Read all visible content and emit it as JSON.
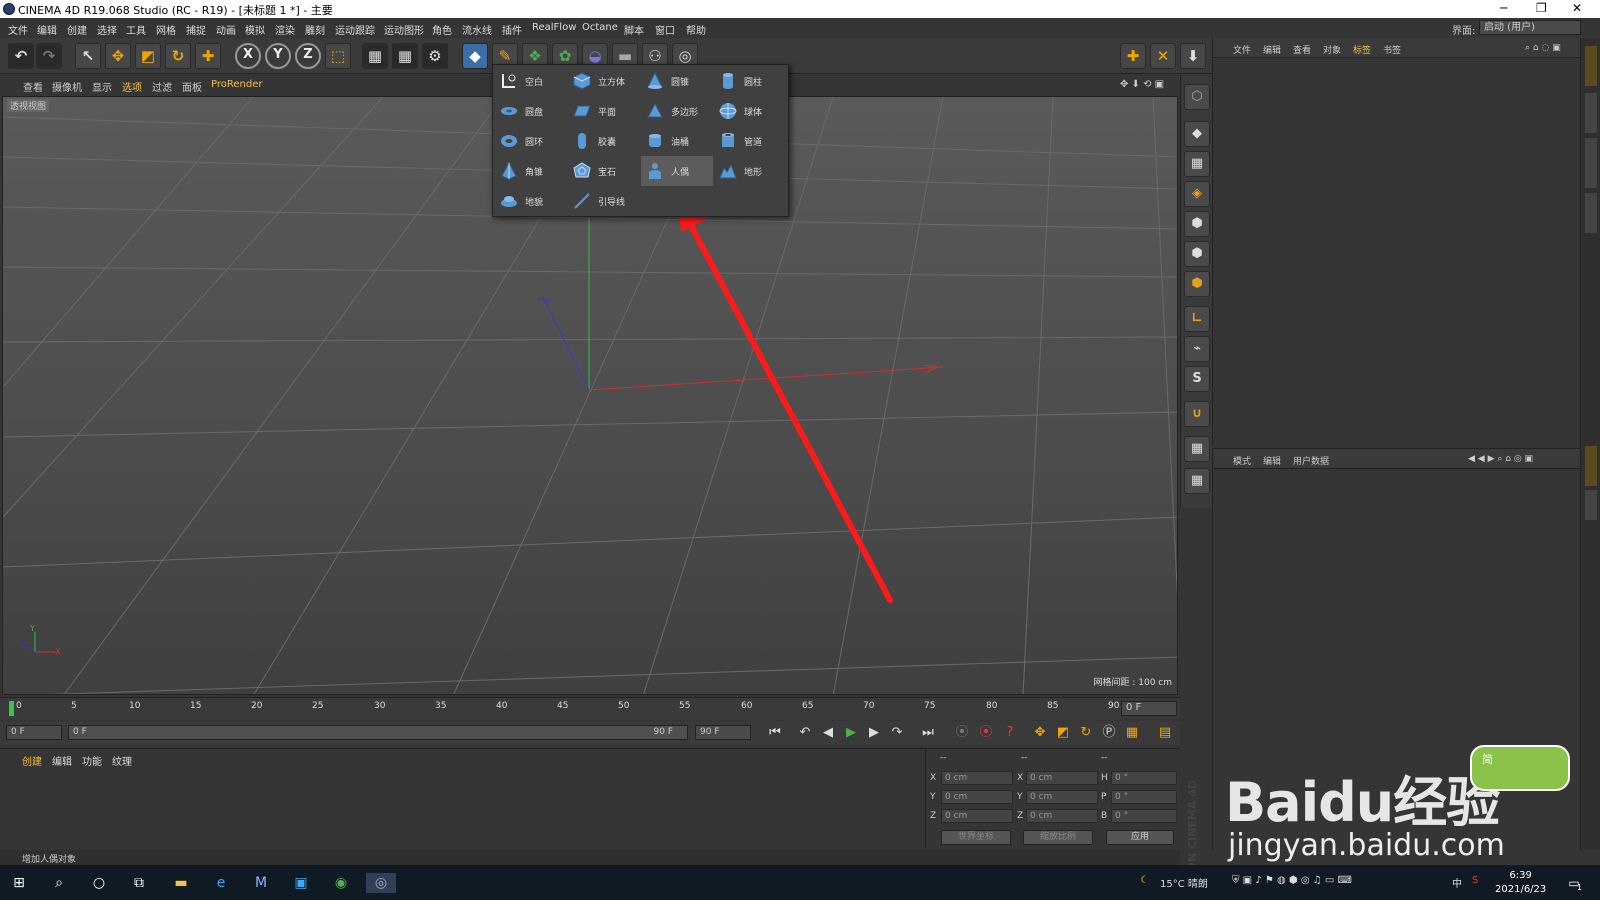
{
  "titlebar": {
    "title": "CINEMA 4D R19.068 Studio (RC - R19) - [未标题 1 *] - 主要",
    "minimize": "─",
    "restore": "❐",
    "close": "✕"
  },
  "menubar": {
    "items": [
      "文件",
      "编辑",
      "创建",
      "选择",
      "工具",
      "网格",
      "捕捉",
      "动画",
      "模拟",
      "渲染",
      "雕刻",
      "运动跟踪",
      "运动图形",
      "角色",
      "流水线",
      "插件",
      "RealFlow",
      "Octane",
      "脚本",
      "窗口",
      "帮助"
    ],
    "interface_label": "界面:",
    "interface_value": "启动 (用户)"
  },
  "viewport_menu": {
    "items": [
      "查看",
      "摄像机",
      "显示",
      "选项",
      "过滤",
      "面板",
      "ProRender"
    ]
  },
  "viewport": {
    "label": "透视视图",
    "grid_info": "网格间距 : 100 cm",
    "axis_y": "Y",
    "axis_x": "X",
    "axis_z": "Z"
  },
  "primitives_menu": {
    "items": [
      {
        "label": "空白",
        "icon": "null-icon"
      },
      {
        "label": "立方体",
        "icon": "cube-icon"
      },
      {
        "label": "圆锥",
        "icon": "cone-icon"
      },
      {
        "label": "圆柱",
        "icon": "cylinder-icon"
      },
      {
        "label": "圆盘",
        "icon": "disc-icon"
      },
      {
        "label": "平面",
        "icon": "plane-icon"
      },
      {
        "label": "多边形",
        "icon": "polygon-icon"
      },
      {
        "label": "球体",
        "icon": "sphere-icon"
      },
      {
        "label": "圆环",
        "icon": "torus-icon"
      },
      {
        "label": "胶囊",
        "icon": "capsule-icon"
      },
      {
        "label": "油桶",
        "icon": "oiltank-icon"
      },
      {
        "label": "管道",
        "icon": "tube-icon"
      },
      {
        "label": "角锥",
        "icon": "pyramid-icon"
      },
      {
        "label": "宝石",
        "icon": "platonic-icon"
      },
      {
        "label": "人偶",
        "icon": "figure-icon"
      },
      {
        "label": "地形",
        "icon": "landscape-icon"
      },
      {
        "label": "地貌",
        "icon": "relief-icon"
      },
      {
        "label": "引导线",
        "icon": "guide-icon"
      }
    ],
    "selected": "人偶"
  },
  "timeline": {
    "ticks": [
      "0",
      "5",
      "10",
      "15",
      "20",
      "25",
      "30",
      "35",
      "40",
      "45",
      "50",
      "55",
      "60",
      "65",
      "70",
      "75",
      "80",
      "85",
      "90"
    ],
    "current_frame": "0 F"
  },
  "transport": {
    "start_frame": "0 F",
    "range_start": "0 F",
    "range_end": "90 F",
    "end_frame": "90 F"
  },
  "material_panel": {
    "tabs": [
      "创建",
      "编辑",
      "功能",
      "纹理"
    ]
  },
  "coord_panel": {
    "headers": [
      "--",
      "--",
      "--"
    ],
    "rows": [
      {
        "axis": "X",
        "pos": "0 cm",
        "axis2": "X",
        "size": "0 cm",
        "axis3": "H",
        "rot": "0 °"
      },
      {
        "axis": "Y",
        "pos": "0 cm",
        "axis2": "Y",
        "size": "0 cm",
        "axis3": "P",
        "rot": "0 °"
      },
      {
        "axis": "Z",
        "pos": "0 cm",
        "axis2": "Z",
        "size": "0 cm",
        "axis3": "B",
        "rot": "0 °"
      }
    ],
    "world_coords": "世界坐标",
    "scale_ratio": "缩放比例",
    "apply": "应用"
  },
  "status": {
    "message": "增加人偶对象"
  },
  "object_manager": {
    "menu": [
      "文件",
      "编辑",
      "查看",
      "对象",
      "标签",
      "书签"
    ]
  },
  "attribute_manager": {
    "menu": [
      "模式",
      "编辑",
      "用户数据"
    ]
  },
  "branding": {
    "maxon": "MAXON CINEMA 4D"
  },
  "watermark": {
    "brand": "Baidu经验",
    "site": "jingyan.baidu.com",
    "badge": "简"
  },
  "taskbar": {
    "weather": "15°C 晴朗",
    "ime": "中",
    "time": "6:39",
    "date": "2021/6/23",
    "notify_count": "1"
  },
  "colors": {
    "accent": "#f0a800",
    "arrow": "#ff1a1a",
    "selected_item": "#5c5c5c"
  }
}
